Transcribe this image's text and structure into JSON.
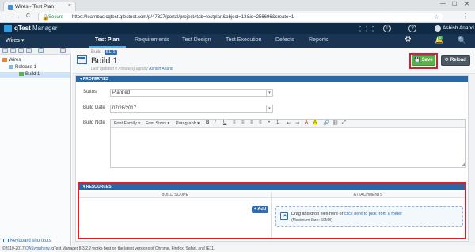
{
  "browser": {
    "tab_title": "Wires - Test Plan",
    "tab_close": "×",
    "secure_label": "Secure",
    "url": "https://learnbasicqtest.qtestnet.com/p/47327/portal/project#tab=testplan&object=13&id=256696&create=1",
    "win_min": "—",
    "win_max": "☐",
    "win_close": "✕",
    "back": "←",
    "forward": "→",
    "refresh": "C"
  },
  "app": {
    "logo_text": "qTest",
    "logo_suffix": "Manager",
    "project": "Wires ▾",
    "user_name": "Ashish Anand",
    "bell_count": "0",
    "nav_tabs": [
      {
        "label": "Test Plan"
      },
      {
        "label": "Requirements"
      },
      {
        "label": "Test Design"
      },
      {
        "label": "Test Execution"
      },
      {
        "label": "Defects"
      },
      {
        "label": "Reports"
      }
    ]
  },
  "tree": {
    "items": [
      {
        "label": "Wires"
      },
      {
        "label": "Release 1"
      },
      {
        "label": "Build 1"
      }
    ],
    "keyboard_shortcuts": "Keyboard shortcuts"
  },
  "build": {
    "type": "Build",
    "id": "BL-1",
    "name": "Build 1",
    "updated_prefix": "Last updated 0 minute(s) ago by",
    "updated_by": "Ashish Anand",
    "save_label": "Save",
    "reload_label": "Reload"
  },
  "properties": {
    "header": "▾ PROPERTIES",
    "status_label": "Status",
    "status_value": "Planned",
    "build_date_label": "Build Date",
    "build_date_value": "07/28/2017",
    "build_note_label": "Build Note",
    "editor": {
      "font_family": "Font Family ▾",
      "font_sizes": "Font Sizes ▾",
      "paragraph": "Paragraph ▾",
      "buttons": [
        "B",
        "I",
        "U",
        "≡",
        "≡",
        "≡",
        "≡",
        "•",
        "1.",
        "⇤",
        "⇥",
        "A",
        "A",
        "🔗",
        "⛓",
        "⤢"
      ]
    }
  },
  "resources": {
    "header": "▾ RESOURCES",
    "col_build_scope": "BUILD SCOPE",
    "col_attachments": "ATTACHMENTS",
    "add_label": "+ Add",
    "drop_text_prefix": "Drag and drop files here or",
    "drop_link": "click here to pick from a folder",
    "drop_sub": "(Maximum Size: 50MB)"
  },
  "footer": {
    "copyright": "©2010-2017",
    "company": "QASymphony",
    "note": ". qTest Manager 8.3.2.2 works best on the latest versions of Chrome, Firefox, Safari, and IE11."
  },
  "colors": {
    "header_bg": "#0f2a44",
    "nav_bg": "#1a3553",
    "accent_blue": "#2a67a6",
    "save_green": "#5cb34a",
    "highlight_red": "#d6202b"
  }
}
